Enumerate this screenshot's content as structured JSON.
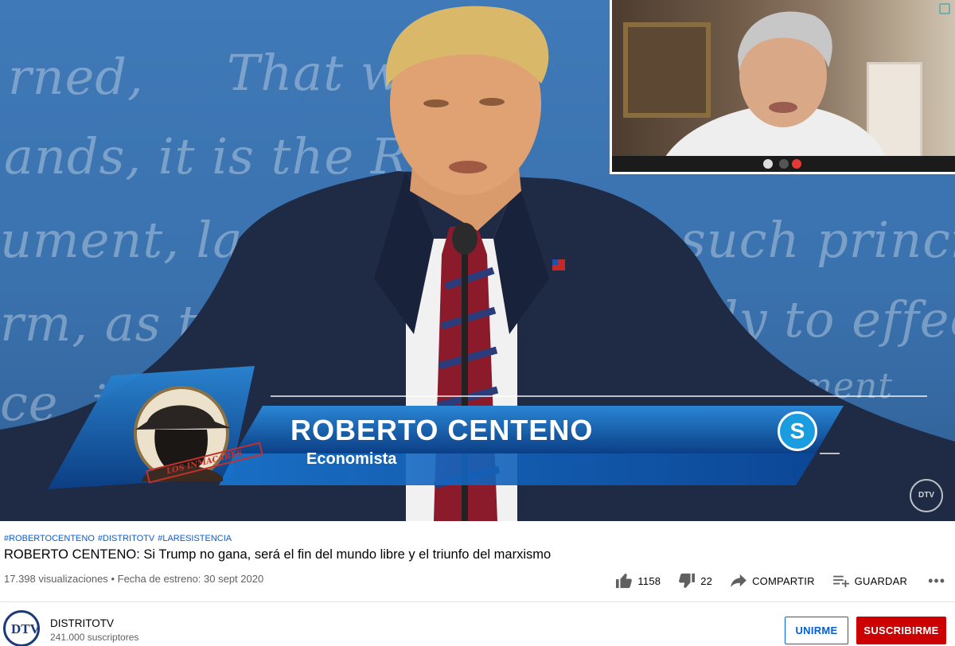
{
  "video": {
    "background_text": [
      "rned,",
      "That w",
      "ands, it is the Righ",
      "ument, lay",
      "such princip",
      "rm, as to",
      "ely to effect",
      "ce, i",
      "vernment"
    ],
    "lower_third": {
      "name": "ROBERTO CENTENO",
      "role": "Economista",
      "logo_text": "LOS INMACARES",
      "badge_letter": "S",
      "watermark": "DTV"
    }
  },
  "hashtags": [
    "#ROBERTOCENTENO",
    "#DISTRITOTV",
    "#LARESISTENCIA"
  ],
  "title": "ROBERTO CENTENO: Si Trump no gana, será el fin del mundo libre y el triunfo del marxismo",
  "meta": {
    "views": "17.398 visualizaciones",
    "separator": "•",
    "premiere": "Fecha de estreno: 30 sept 2020"
  },
  "actions": {
    "likes": "1158",
    "dislikes": "22",
    "share": "COMPARTIR",
    "save": "GUARDAR",
    "more": "•••"
  },
  "channel": {
    "avatar_text": "DTV",
    "name": "DISTRITOTV",
    "subscribers": "241.000 suscriptores"
  },
  "buttons": {
    "join": "UNIRME",
    "subscribe": "SUSCRIBIRME"
  },
  "colors": {
    "link": "#065fd4",
    "subscribe": "#cc0000",
    "muted": "#606060"
  }
}
